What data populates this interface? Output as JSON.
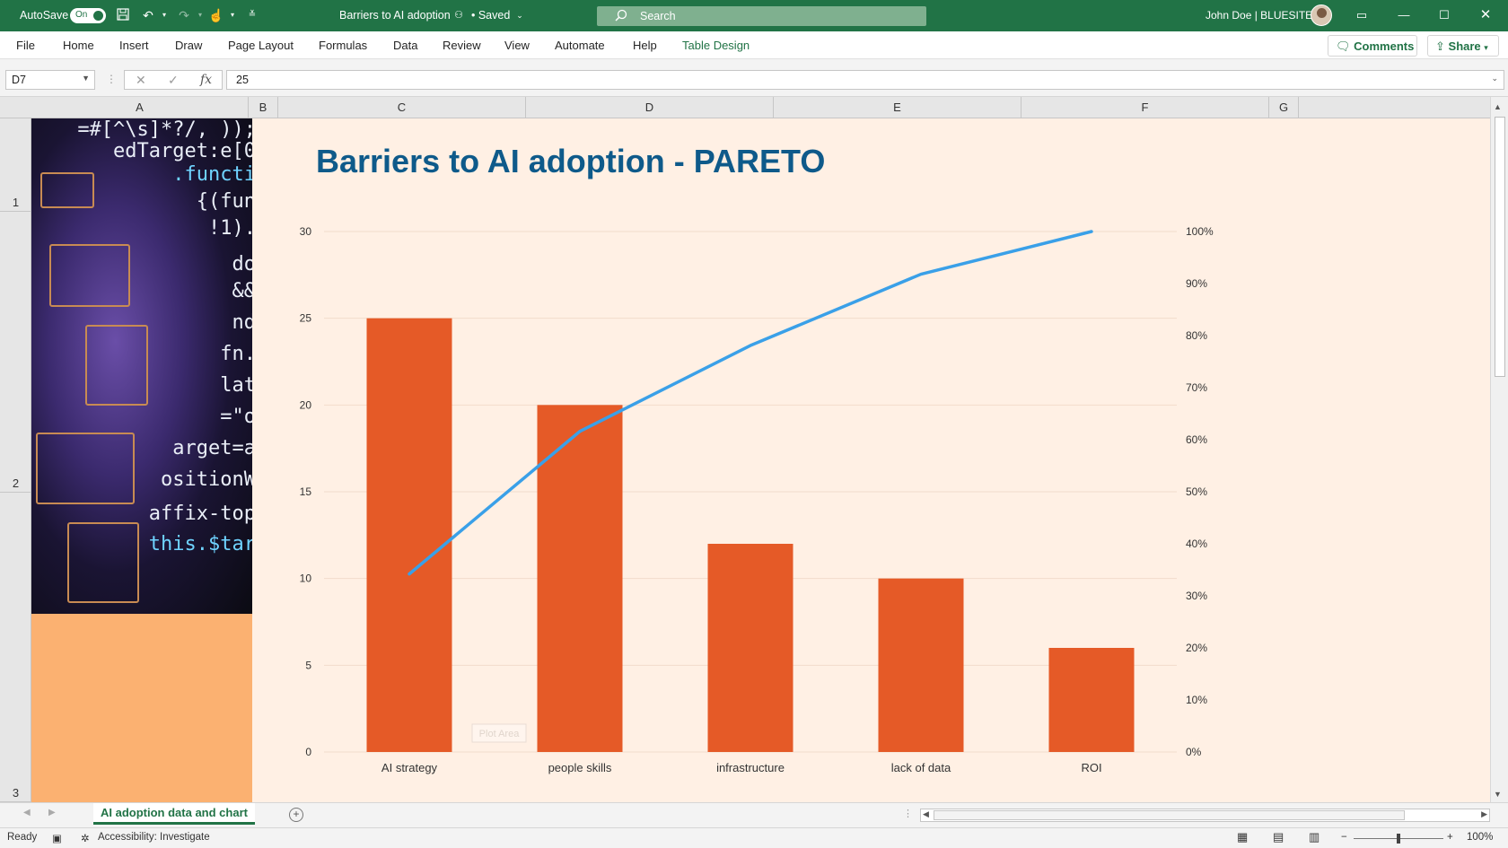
{
  "titlebar": {
    "autosave_label": "AutoSave",
    "autosave_state": "On",
    "doc_title": "Barriers to AI adoption",
    "save_status": "• Saved",
    "search_placeholder": "Search",
    "user": "John Doe | BLUESITE",
    "accent": "#217346"
  },
  "ribbon": {
    "tabs": [
      "File",
      "Home",
      "Insert",
      "Draw",
      "Page Layout",
      "Formulas",
      "Data",
      "Review",
      "View",
      "Automate",
      "Help",
      "Table Design"
    ],
    "comments": "Comments",
    "share": "Share"
  },
  "formula_bar": {
    "name_box": "D7",
    "fx": "fx",
    "value": "25"
  },
  "grid": {
    "columns": [
      "A",
      "B",
      "C",
      "D",
      "E",
      "F",
      "G"
    ],
    "rows": [
      "1",
      "2",
      "3"
    ]
  },
  "chart_data": {
    "type": "bar",
    "title": "Barriers to AI adoption - PARETO",
    "categories": [
      "AI strategy",
      "people skills",
      "infrastructure",
      "lack of data",
      "ROI"
    ],
    "series": [
      {
        "type": "bar",
        "values": [
          25,
          20,
          12,
          10,
          6
        ],
        "color": "#e55a27",
        "axis": "left"
      },
      {
        "type": "line",
        "values": [
          0.342,
          0.616,
          0.781,
          0.918,
          1.0
        ],
        "color": "#3aa0e8",
        "axis": "right"
      }
    ],
    "y_left": {
      "min": 0,
      "max": 30,
      "ticks": [
        "0",
        "5",
        "10",
        "15",
        "20",
        "25",
        "30"
      ]
    },
    "y_right": {
      "min": 0,
      "max": 1,
      "ticks": [
        "0%",
        "10%",
        "20%",
        "30%",
        "40%",
        "50%",
        "60%",
        "70%",
        "80%",
        "90%",
        "100%"
      ]
    },
    "grid": true,
    "plot_area_tooltip": "Plot Area",
    "title_color": "#0e5a8a",
    "background": "#fff0e4"
  },
  "sheet_tab": "AI adoption data and chart",
  "status": {
    "ready": "Ready",
    "accessibility": "Accessibility: Investigate",
    "zoom": "100%"
  }
}
